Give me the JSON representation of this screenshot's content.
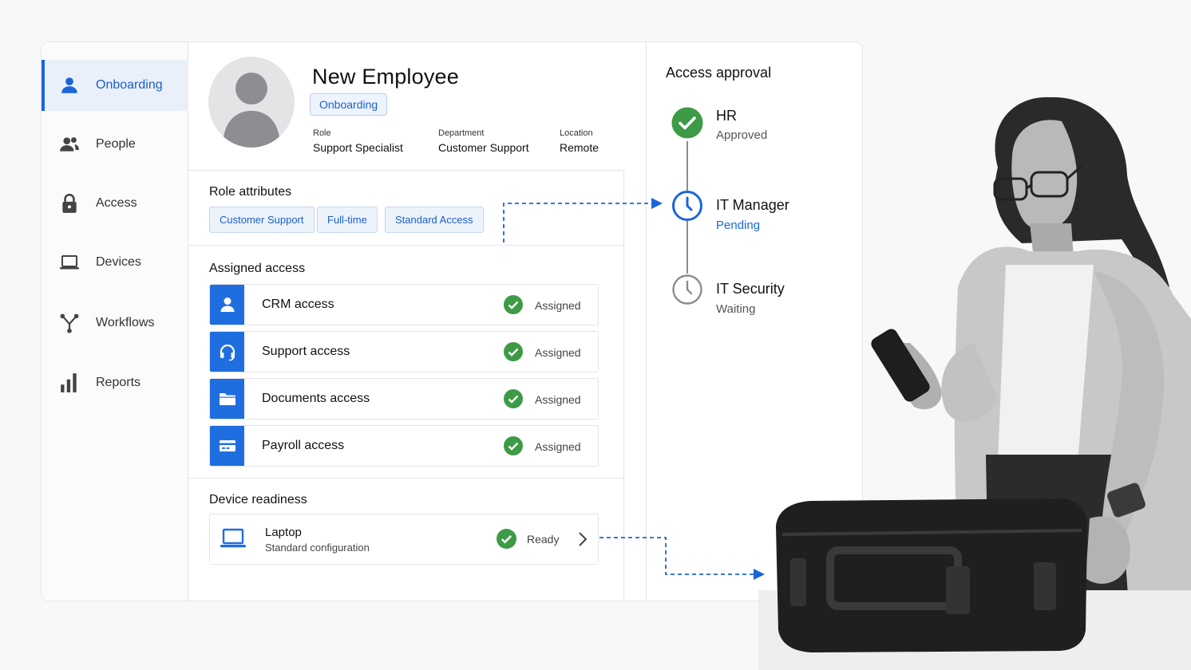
{
  "sidebar": {
    "items": [
      {
        "label": "Onboarding",
        "icon": "person-icon",
        "active": true
      },
      {
        "label": "People",
        "icon": "people-icon",
        "active": false
      },
      {
        "label": "Access",
        "icon": "lock-icon",
        "active": false
      },
      {
        "label": "Devices",
        "icon": "laptop-icon",
        "active": false
      },
      {
        "label": "Workflows",
        "icon": "workflow-icon",
        "active": false
      },
      {
        "label": "Reports",
        "icon": "bar-chart-icon",
        "active": false
      }
    ]
  },
  "employee": {
    "name": "New Employee",
    "status": "Onboarding",
    "role_label": "Role",
    "role": "Support Specialist",
    "department_label": "Department",
    "department": "Customer Support",
    "location_label": "Location",
    "location": "Remote"
  },
  "role_attributes": {
    "title": "Role attributes",
    "chips": [
      "Customer Support",
      "Full-time",
      "Standard Access"
    ]
  },
  "assigned_access": {
    "title": "Assigned access",
    "rows": [
      {
        "name": "CRM access",
        "status": "Assigned",
        "icon": "user-icon"
      },
      {
        "name": "Support access",
        "status": "Assigned",
        "icon": "headset-icon"
      },
      {
        "name": "Documents access",
        "status": "Assigned",
        "icon": "folder-icon"
      },
      {
        "name": "Payroll access",
        "status": "Assigned",
        "icon": "card-icon"
      }
    ]
  },
  "device_readiness": {
    "title": "Device readiness",
    "device": {
      "name": "Laptop",
      "subtitle": "Standard configuration",
      "status": "Ready"
    }
  },
  "approvals": {
    "title": "Access approval",
    "steps": [
      {
        "name": "HR",
        "status": "Approved",
        "state": "approved"
      },
      {
        "name": "IT Manager",
        "status": "Pending",
        "state": "pending"
      },
      {
        "name": "IT Security",
        "status": "Waiting",
        "state": "waiting"
      }
    ]
  },
  "colors": {
    "accent": "#1a66d9",
    "success": "#3d9a45",
    "pending": "#1a66d9",
    "waiting": "#8a8c90"
  }
}
